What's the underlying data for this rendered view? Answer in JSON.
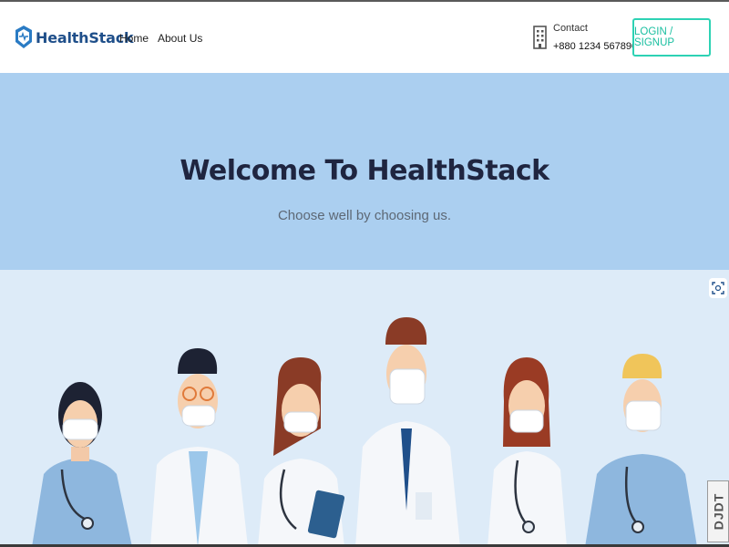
{
  "brand": {
    "name": "HealthStack"
  },
  "nav": {
    "home": "Home",
    "about": "About Us"
  },
  "contact": {
    "label": "Contact",
    "phone": "+880 1234 567890"
  },
  "auth": {
    "button_label": "LOGIN / SIGNUP"
  },
  "hero": {
    "title": "Welcome To HealthStack",
    "subtitle": "Choose well by choosing us."
  },
  "toolbar": {
    "debug_label": "DJDT"
  },
  "colors": {
    "accent": "#2dd2b4",
    "hero_bg": "#abcff0",
    "brand": "#1f4f8a",
    "illustration_bg": "#ddebf8"
  },
  "icons": [
    "logo-icon",
    "building-icon",
    "expand-icon"
  ]
}
